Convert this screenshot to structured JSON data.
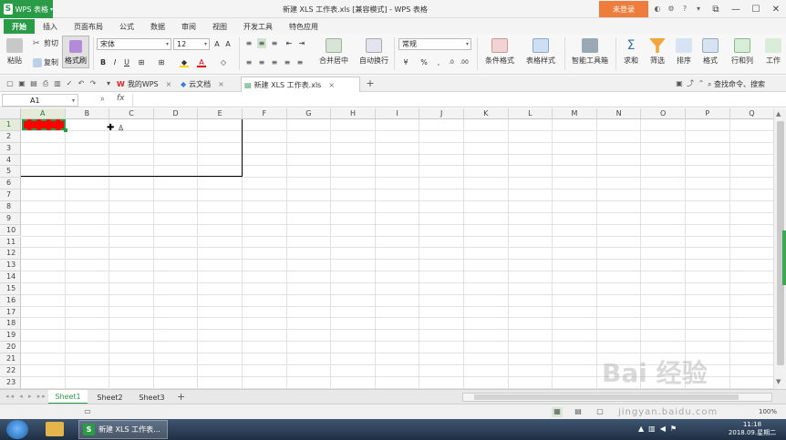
{
  "app": {
    "name": "WPS 表格",
    "logo": "S",
    "window_title": "新建 XLS 工作表.xls [兼容模式] - WPS 表格",
    "login_label": "未登录"
  },
  "ribbon_tabs": [
    "开始",
    "插入",
    "页面布局",
    "公式",
    "数据",
    "审阅",
    "视图",
    "开发工具",
    "特色应用"
  ],
  "ribbon": {
    "paste": "粘贴",
    "cut": "剪切",
    "copy": "复制",
    "format_painter": "格式刷",
    "font_name": "宋体",
    "font_size": "12",
    "bold": "B",
    "italic": "I",
    "underline": "U",
    "merge_center": "合并居中",
    "wrap_text": "自动换行",
    "number_format": "常规",
    "percent": "%",
    "cond_format": "条件格式",
    "table_style": "表格样式",
    "smart_toolbox": "智能工具箱",
    "sum": "求和",
    "filter": "筛选",
    "sort": "排序",
    "format": "格式",
    "rows_cols": "行和列",
    "worksheet": "工作"
  },
  "doc_tabs": [
    {
      "label": "我的WPS"
    },
    {
      "label": "云文档"
    },
    {
      "label": "新建 XLS 工作表.xls"
    }
  ],
  "search_cmd": "查找命令、搜索",
  "formula_bar": {
    "cell_ref": "A1",
    "fx": "fx",
    "content": ""
  },
  "columns": [
    "A",
    "B",
    "C",
    "D",
    "E",
    "F",
    "G",
    "H",
    "I",
    "J",
    "K",
    "L",
    "M",
    "N",
    "O",
    "P",
    "Q"
  ],
  "rows": [
    "1",
    "2",
    "3",
    "4",
    "5",
    "6",
    "7",
    "8",
    "9",
    "10",
    "11",
    "12",
    "13",
    "14",
    "15",
    "16",
    "17",
    "18",
    "19",
    "20",
    "21",
    "22",
    "23"
  ],
  "selected_cell": {
    "ref": "A1",
    "fill_color": "#ff0000"
  },
  "sheets": [
    "Sheet1",
    "Sheet2",
    "Sheet3"
  ],
  "active_sheet": "Sheet1",
  "status": {
    "zoom": "100%"
  },
  "taskbar": {
    "app_label": "新建 XLS 工作表...",
    "time": "11:18",
    "date": "2018.09.星期二"
  },
  "watermark": {
    "text": "Bai 经验",
    "url": "jingyan.baidu.com"
  },
  "colors": {
    "accent": "#2a9b47",
    "login": "#ee7c3d",
    "fill": "#ff0000"
  }
}
